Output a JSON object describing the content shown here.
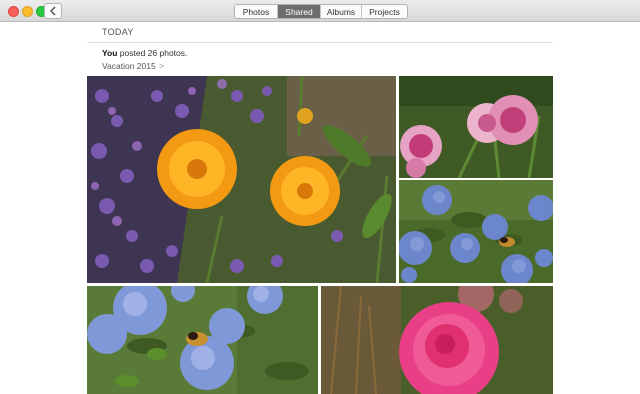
{
  "window": {
    "tabs": [
      {
        "label": "Photos",
        "active": false
      },
      {
        "label": "Shared",
        "active": true
      },
      {
        "label": "Albums",
        "active": false
      },
      {
        "label": "Projects",
        "active": false
      }
    ]
  },
  "feed": {
    "section_title": "TODAY",
    "activity_user": "You",
    "activity_text": " posted 26 photos.",
    "album_name": "Vacation 2015",
    "album_chevron": ">"
  },
  "icons": {
    "back": "chevron-left-icon"
  },
  "colors": {
    "active_tab": "#6d6d6d",
    "close": "#fc5f57",
    "minimize": "#fdbc2e",
    "maximize": "#29c941"
  }
}
